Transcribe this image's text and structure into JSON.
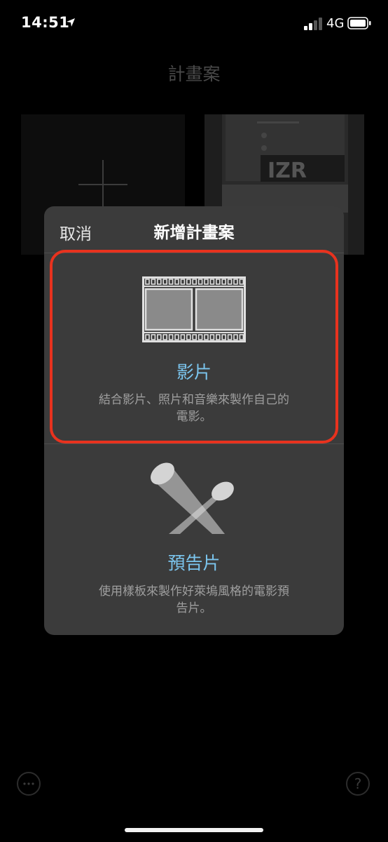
{
  "status_bar": {
    "time": "14:51",
    "network": "4G",
    "icons": [
      "location-arrow-icon",
      "signal-icon",
      "battery-icon"
    ]
  },
  "background": {
    "title": "計畫案",
    "help_label": "?"
  },
  "sheet": {
    "cancel_label": "取消",
    "title": "新增計畫案",
    "options": [
      {
        "title": "影片",
        "description": "結合影片、照片和音樂來製作自己的電影。",
        "icon": "film-strip-icon",
        "highlighted": true
      },
      {
        "title": "預告片",
        "description": "使用樣板來製作好萊塢風格的電影預告片。",
        "icon": "spotlights-icon",
        "highlighted": false
      }
    ]
  },
  "colors": {
    "accent": "#7bc5ee",
    "highlight": "#e8321e",
    "sheet_bg": "#3b3b3b"
  }
}
